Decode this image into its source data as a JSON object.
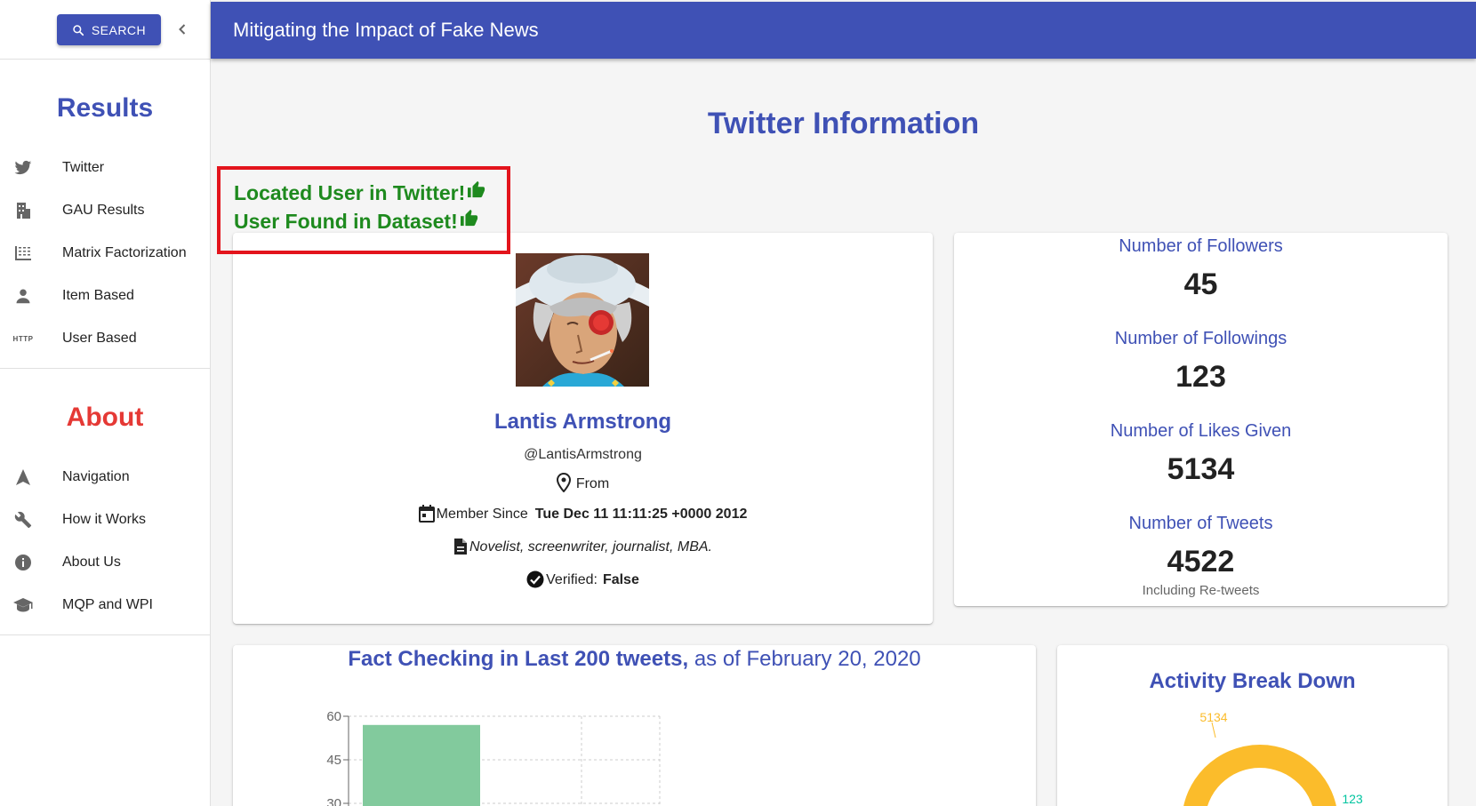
{
  "sidebar": {
    "search_label": "SEARCH",
    "results_title": "Results",
    "results_items": [
      {
        "label": "Twitter",
        "icon": "twitter-icon"
      },
      {
        "label": "GAU Results",
        "icon": "building-icon"
      },
      {
        "label": "Matrix Factorization",
        "icon": "grid-icon"
      },
      {
        "label": "Item Based",
        "icon": "person-icon"
      },
      {
        "label": "User Based",
        "icon": "http-icon"
      }
    ],
    "about_title": "About",
    "about_items": [
      {
        "label": "Navigation",
        "icon": "navigation-arrow-icon"
      },
      {
        "label": "How it Works",
        "icon": "wrench-icon"
      },
      {
        "label": "About Us",
        "icon": "info-icon"
      },
      {
        "label": "MQP and WPI",
        "icon": "graduation-cap-icon"
      }
    ]
  },
  "appbar": {
    "title": "Mitigating the Impact of Fake News"
  },
  "main": {
    "page_title": "Twitter Information",
    "status": {
      "line1": "Located User in Twitter!",
      "line2": "User Found in Dataset!"
    },
    "profile": {
      "name": "Lantis Armstrong",
      "handle": "@LantisArmstrong",
      "from_label": "From",
      "member_since_label": "Member Since",
      "member_since_value": "Tue Dec 11 11:11:25 +0000 2012",
      "bio": "Novelist, screenwriter, journalist, MBA.",
      "verified_label": "Verified:",
      "verified_value": "False"
    },
    "stats": {
      "followers_label": "Number of Followers",
      "followers_value": "45",
      "followings_label": "Number of Followings",
      "followings_value": "123",
      "likes_label": "Number of Likes Given",
      "likes_value": "5134",
      "tweets_label": "Number of Tweets",
      "tweets_value": "4522",
      "tweets_note": "Including Re-tweets"
    },
    "fact_checking": {
      "title_bold": "Fact Checking in Last 200 tweets,",
      "title_rest": "as of February 20, 2020"
    },
    "activity": {
      "title": "Activity Break Down",
      "label_likes": "5134",
      "label_followings": "123"
    }
  },
  "colors": {
    "primary": "#3f51b5",
    "about_red": "#e53935",
    "status_green": "#1e8a1e",
    "highlight_red": "#e3141c",
    "bar_green": "#82ca9d",
    "donut_orange": "#fbbc2b",
    "donut_teal": "#00c49f"
  },
  "chart_data": {
    "type": "bar",
    "categories": [
      ""
    ],
    "values": [
      57
    ],
    "yticks": [
      30,
      45,
      60
    ],
    "ylim": [
      0,
      60
    ],
    "grid": true
  }
}
